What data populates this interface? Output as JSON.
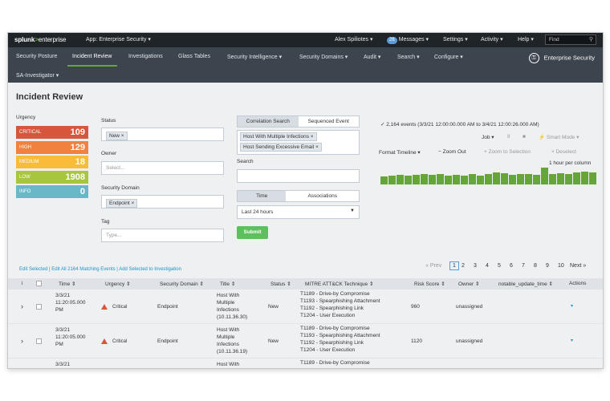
{
  "topbar": {
    "logo_main": "splunk",
    "logo_gt": ">",
    "logo_ent": "enterprise",
    "app": "App: Enterprise Security ▾",
    "user": "Alex Spiliotes ▾",
    "messages_count": "26",
    "messages": "Messages ▾",
    "settings": "Settings ▾",
    "activity": "Activity ▾",
    "help": "Help ▾",
    "find": "Find"
  },
  "nav": {
    "items": [
      "Security Posture",
      "Incident Review",
      "Investigations",
      "Glass Tables",
      "Security Intelligence ▾",
      "Security Domains ▾",
      "Audit ▾",
      "Search ▾",
      "Configure ▾"
    ],
    "row2": "SA-Investigator ▾",
    "brand": "Enterprise Security"
  },
  "page_title": "Incident Review",
  "urgency": {
    "label": "Urgency",
    "items": [
      {
        "name": "CRITICAL",
        "count": "109",
        "color": "#d6563c"
      },
      {
        "name": "HIGH",
        "count": "129",
        "color": "#f1813f"
      },
      {
        "name": "MEDIUM",
        "count": "18",
        "color": "#f7bc38"
      },
      {
        "name": "LOW",
        "count": "1908",
        "color": "#a7c63d"
      },
      {
        "name": "INFO",
        "count": "0",
        "color": "#6ab7c7"
      }
    ]
  },
  "filters": {
    "status_label": "Status",
    "status_chip": "New ×",
    "owner_label": "Owner",
    "owner_placeholder": "Select...",
    "domain_label": "Security Domain",
    "domain_chip": "Endpoint ×",
    "tag_label": "Tag",
    "tag_placeholder": "Type...",
    "tab_correlation": "Correlation Search",
    "tab_sequenced": "Sequenced Event",
    "search_chip_1": "Host With Multiple Infections ×",
    "search_chip_2": "Host Sending Excessive Email ×",
    "search_label": "Search",
    "tab_time": "Time",
    "tab_associations": "Associations",
    "time_value": "Last 24 hours",
    "submit": "Submit"
  },
  "timeline": {
    "events": "✓ 2,164 events (3/3/21 12:00:00.000 AM to 3/4/21 12:00:26.000 AM)",
    "job": "Job ▾",
    "pause": "II",
    "stop": "■",
    "smart_mode": "⚡ Smart Mode ▾",
    "format": "Format Timeline ▾",
    "zoom_out": "− Zoom Out",
    "zoom_sel": "+ Zoom to Selection",
    "deselect": "× Deselect",
    "scale": "1 hour per column",
    "bars": [
      0.45,
      0.5,
      0.55,
      0.5,
      0.55,
      0.6,
      0.55,
      0.6,
      0.5,
      0.55,
      0.5,
      0.6,
      0.5,
      0.6,
      0.7,
      0.65,
      0.55,
      0.6,
      0.6,
      0.55,
      0.95,
      0.6,
      0.65,
      0.6,
      0.7,
      0.75,
      0.7
    ]
  },
  "actions_links": "Edit Selected | Edit All 2164 Matching Events | Add Selected to Investigation",
  "pager": {
    "prev": "« Prev",
    "pages": [
      "1",
      "2",
      "3",
      "4",
      "5",
      "6",
      "7",
      "8",
      "9",
      "10"
    ],
    "next": "Next »"
  },
  "table": {
    "headers": [
      "i",
      "Time ⇕",
      "Urgency ⇕",
      "Security Domain ⇕",
      "Title ⇕",
      "Status ⇕",
      "MITRE ATT&CK Technique ⇕",
      "Risk Score ⇕",
      "Owner ⇕",
      "notable_update_time ⇕",
      "Actions"
    ],
    "rows": [
      {
        "time": [
          "3/3/21",
          "11:20:05.000",
          "PM"
        ],
        "urgency": "Critical",
        "domain": "Endpoint",
        "title": [
          "Host With",
          "Multiple",
          "Infections",
          "(10.11.36.30)"
        ],
        "status": "New",
        "mitre": [
          "T1189 - Drive-by Compromise",
          "T1193 - Spearphishing Attachment",
          "T1192 - Spearphishing Link",
          "T1204 - User Execution"
        ],
        "risk": "960",
        "owner": "unassigned"
      },
      {
        "time": [
          "3/3/21",
          "11:20:05.000",
          "PM"
        ],
        "urgency": "Critical",
        "domain": "Endpoint",
        "title": [
          "Host With",
          "Multiple",
          "Infections",
          "(10.11.36.19)"
        ],
        "status": "New",
        "mitre": [
          "T1189 - Drive-by Compromise",
          "T1193 - Spearphishing Attachment",
          "T1192 - Spearphishing Link",
          "T1204 - User Execution"
        ],
        "risk": "1120",
        "owner": "unassigned"
      },
      {
        "time": [
          "3/3/21",
          "",
          ""
        ],
        "urgency": "",
        "domain": "",
        "title": [
          "Host With",
          "",
          "",
          ""
        ],
        "status": "",
        "mitre": [
          "T1189 - Drive-by Compromise",
          "",
          "",
          ""
        ],
        "risk": "",
        "owner": ""
      }
    ]
  }
}
